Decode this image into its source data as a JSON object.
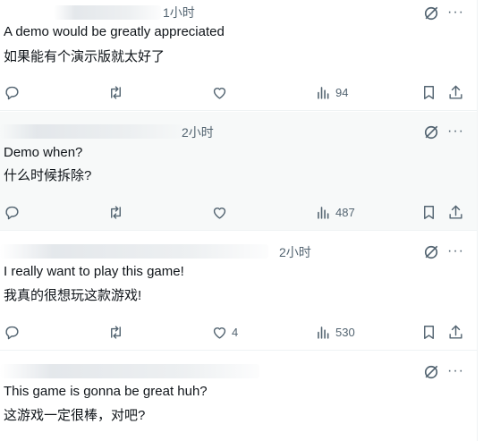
{
  "replies": [
    {
      "time": "1小时",
      "text_en": "A demo would be greatly appreciated",
      "text_zh": "如果能有个演示版就太好了",
      "likes": "",
      "views": "94"
    },
    {
      "time": "2小时",
      "text_en": "Demo when?",
      "text_zh": "什么时候拆除?",
      "likes": "",
      "views": "487"
    },
    {
      "time": "2小时",
      "text_en": "I really want to play this game!",
      "text_zh": "我真的很想玩这款游戏!",
      "likes": "4",
      "views": "530"
    },
    {
      "time": "",
      "text_en": "This game is gonna be great huh?",
      "text_zh": "这游戏一定很棒，对吧?",
      "likes": "",
      "views": ""
    }
  ],
  "more_glyph": "···",
  "icons": [
    "reply-icon",
    "retweet-icon",
    "like-icon",
    "views-icon",
    "bookmark-icon",
    "share-icon",
    "grok-icon"
  ],
  "colors": {
    "icon": "#536471",
    "text": "#0f1419",
    "divider": "#eff3f4",
    "hover_bg": "#f7f9f9"
  }
}
